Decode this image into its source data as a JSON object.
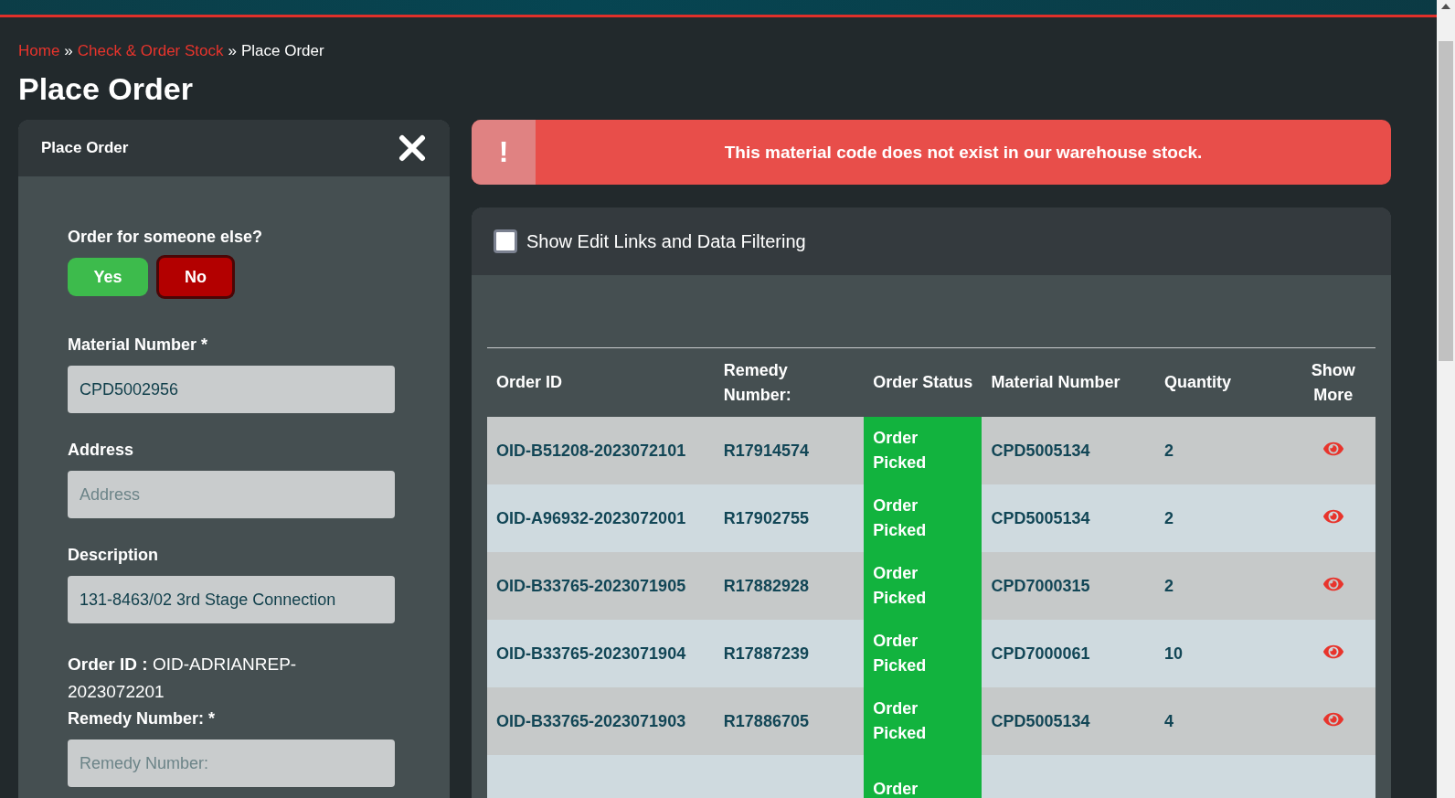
{
  "breadcrumb": {
    "separator": "»",
    "items": [
      {
        "label": "Home",
        "current": false
      },
      {
        "label": "Check & Order Stock",
        "current": false
      },
      {
        "label": "Place Order",
        "current": true
      }
    ]
  },
  "page_title": "Place Order",
  "form_panel": {
    "title": "Place Order",
    "question": "Order for someone else?",
    "choices": [
      {
        "label": "Yes",
        "selected": false,
        "color": "#3dbb4c"
      },
      {
        "label": "No",
        "selected": true,
        "color": "#b30000"
      }
    ],
    "fields": [
      {
        "label": "Material Number *",
        "value": "CPD5002956"
      },
      {
        "label": "Address",
        "placeholder": "Address"
      },
      {
        "label": "Description",
        "value": "131-8463/02 3rd Stage Connection"
      }
    ],
    "order_id": "**Order ID :**  OID-ADRIANREP-2023072201",
    "remedy_field": {
      "label": "Remedy Number: *",
      "placeholder": "Remedy Number:"
    }
  },
  "alert": {
    "icon": "!",
    "message": "This material code does not exist in our warehouse stock."
  },
  "orders_panel": {
    "filter_toggle": {
      "label": "Show Edit Links and Data Filtering",
      "checked": false
    },
    "table": {
      "columns": [
        "Order ID",
        "Remedy Number:",
        "Order Status",
        "Material Number",
        "Quantity",
        "Show More"
      ],
      "rows": [
        {
          "order_id": "OID-B51208-2023072101",
          "remedy": "R17914574",
          "status": "Order Picked",
          "material": "CPD5005134",
          "quantity": "2"
        },
        {
          "order_id": "OID-A96932-2023072001",
          "remedy": "R17902755",
          "status": "Order Picked",
          "material": "CPD5005134",
          "quantity": "2"
        },
        {
          "order_id": "OID-B33765-2023071905",
          "remedy": "R17882928",
          "status": "Order Picked",
          "material": "CPD7000315",
          "quantity": "2"
        },
        {
          "order_id": "OID-B33765-2023071904",
          "remedy": "R17887239",
          "status": "Order Picked",
          "material": "CPD7000061",
          "quantity": "10"
        },
        {
          "order_id": "OID-B33765-2023071903",
          "remedy": "R17886705",
          "status": "Order Picked",
          "material": "CPD5005134",
          "quantity": "4"
        },
        {
          "status": "Order"
        }
      ]
    }
  }
}
